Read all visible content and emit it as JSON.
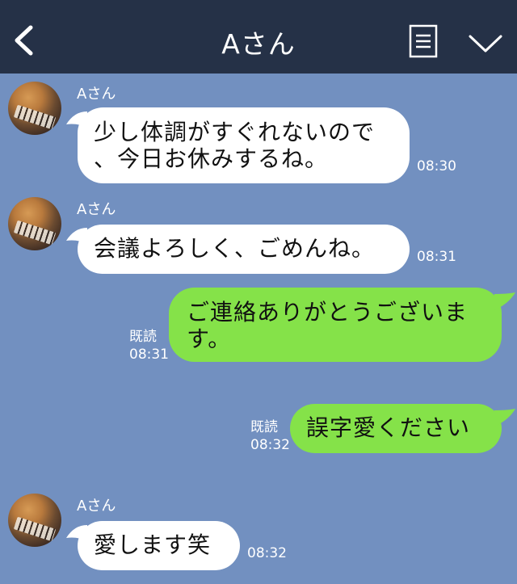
{
  "header": {
    "title": "Aさん",
    "back_icon": "chevron-left-icon",
    "notes_icon": "notes-icon",
    "menu_icon": "chevron-down-icon",
    "background": "#253147"
  },
  "chat": {
    "background": "#7290c0",
    "incoming_bubble_color": "#ffffff",
    "outgoing_bubble_color": "#85e249",
    "messages": [
      {
        "sender": "Aさん",
        "lines": [
          "少し体調がすぐれないので",
          "、今日お休みするね。"
        ],
        "time": "08:30"
      },
      {
        "sender": "Aさん",
        "lines": [
          "会議よろしく、ごめんね。"
        ],
        "time": "08:31"
      },
      {
        "lines": [
          "ご連絡ありがとうございま",
          "す。"
        ],
        "read": "既読",
        "time": "08:31"
      },
      {
        "lines": [
          "誤字愛ください"
        ],
        "read": "既読",
        "time": "08:32"
      },
      {
        "sender": "Aさん",
        "lines": [
          "愛します笑"
        ],
        "time": "08:32"
      }
    ]
  }
}
